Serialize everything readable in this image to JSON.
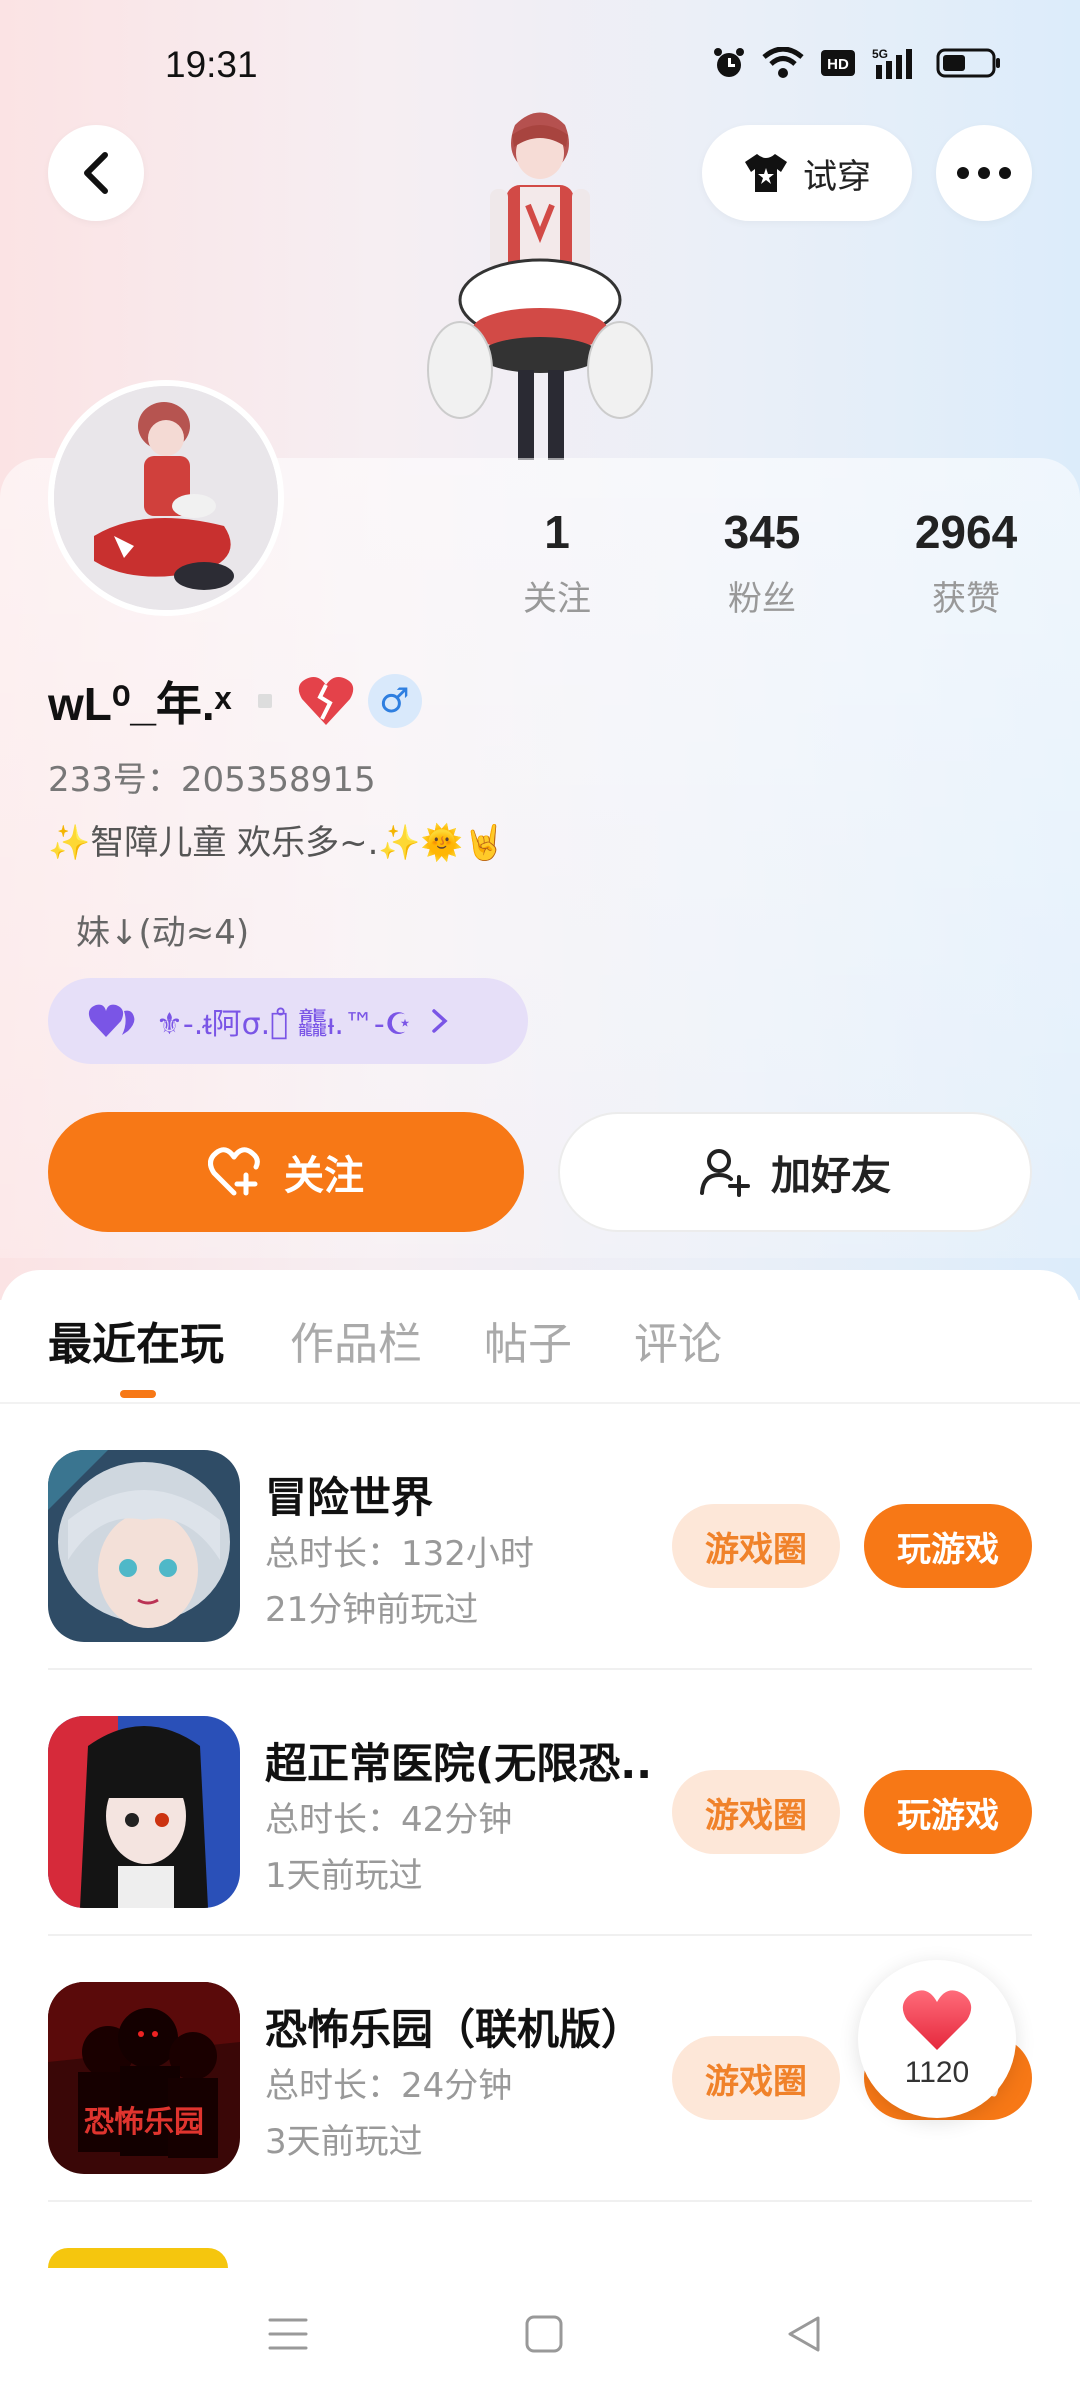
{
  "status_bar": {
    "time": "19:31",
    "icons": [
      "alarm-icon",
      "wifi-icon",
      "hd-icon",
      "5g-signal-icon",
      "battery-icon"
    ]
  },
  "header": {
    "try_on_label": "试穿"
  },
  "profile": {
    "stats": [
      {
        "value": "1",
        "label": "关注"
      },
      {
        "value": "345",
        "label": "粉丝"
      },
      {
        "value": "2964",
        "label": "获赞"
      }
    ],
    "username": "wL⁰_年.ˣ",
    "gender": "♂",
    "user_id": "233号：205358915",
    "bio": "✨智障儿童 欢乐多~.✨🌞🤘",
    "bio2": "妹↓(动≈4)",
    "guild_text": "⚜-.ᵵ阿σ.ℊ̊ 龘ᵼ.™-☪"
  },
  "actions": {
    "follow_label": "关注",
    "add_friend_label": "加好友"
  },
  "tabs": [
    "最近在玩",
    "作品栏",
    "帖子",
    "评论"
  ],
  "games": [
    {
      "title": "冒险世界",
      "duration": "总时长：132小时",
      "last_played": "21分钟前玩过",
      "circle_label": "游戏圈",
      "play_label": "玩游戏"
    },
    {
      "title": "超正常医院(无限恐...",
      "duration": "总时长：42分钟",
      "last_played": "1天前玩过",
      "circle_label": "游戏圈",
      "play_label": "玩游戏"
    },
    {
      "title": "恐怖乐园（联机版）",
      "duration": "总时长：24分钟",
      "last_played": "3天前玩过",
      "circle_label": "游戏圈",
      "play_label": "玩游戏"
    }
  ],
  "game3_icon_text": "恐怖乐园",
  "like_fab": {
    "count": "1120"
  },
  "colors": {
    "accent": "#f77816",
    "circle_bg": "#fde7d8",
    "guild_bg": "#e6dff8"
  }
}
